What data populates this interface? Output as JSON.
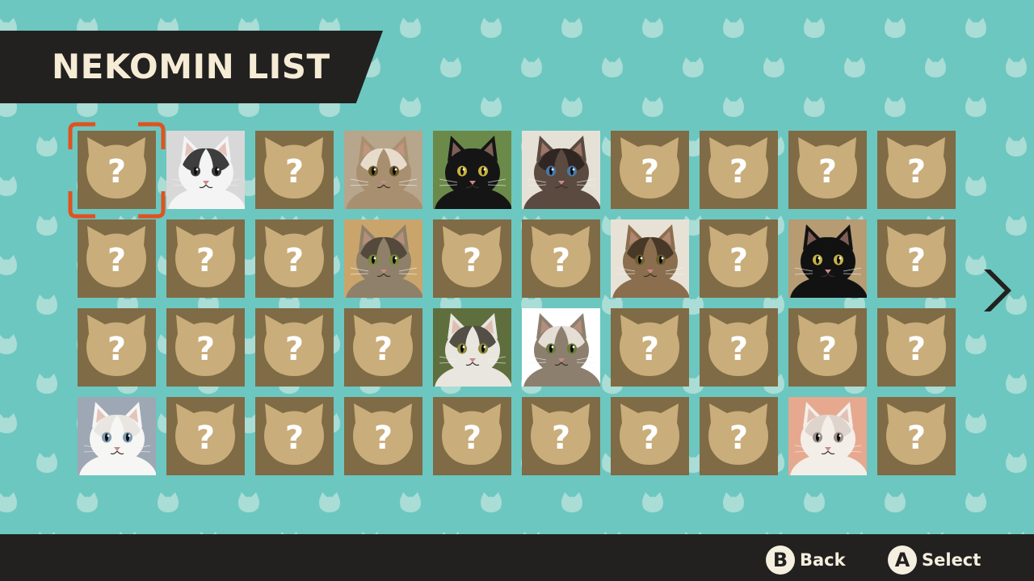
{
  "header": {
    "title": "NEKOMIN LIST"
  },
  "colors": {
    "background": "#6cc7c0",
    "pattern": "#a9ddd6",
    "tile_unknown": "#7f6b45",
    "tile_cat_shape": "#c9ad7a",
    "cursor": "#e0521f",
    "bar": "#222120",
    "bar_text": "#f5efe0"
  },
  "grid": {
    "columns": 10,
    "rows": 4,
    "selected_index": 0,
    "unknown_symbol": "?",
    "tiles": [
      {
        "state": "unknown"
      },
      {
        "state": "discovered",
        "photo": "black-and-white-cat-photo"
      },
      {
        "state": "unknown"
      },
      {
        "state": "discovered",
        "photo": "fluffy-long-haired-cat-photo"
      },
      {
        "state": "discovered",
        "photo": "black-cat-lying-photo"
      },
      {
        "state": "discovered",
        "photo": "siamese-cat-photo"
      },
      {
        "state": "unknown"
      },
      {
        "state": "unknown"
      },
      {
        "state": "unknown"
      },
      {
        "state": "unknown"
      },
      {
        "state": "unknown"
      },
      {
        "state": "unknown"
      },
      {
        "state": "unknown"
      },
      {
        "state": "discovered",
        "photo": "tabby-cat-photo"
      },
      {
        "state": "unknown"
      },
      {
        "state": "unknown"
      },
      {
        "state": "discovered",
        "photo": "tabby-cat-looking-up-photo"
      },
      {
        "state": "unknown"
      },
      {
        "state": "discovered",
        "photo": "black-cat-in-box-photo"
      },
      {
        "state": "unknown"
      },
      {
        "state": "unknown"
      },
      {
        "state": "unknown"
      },
      {
        "state": "unknown"
      },
      {
        "state": "unknown"
      },
      {
        "state": "discovered",
        "photo": "tabby-and-white-cat-photo"
      },
      {
        "state": "discovered",
        "photo": "tabby-cat-closeup-photo"
      },
      {
        "state": "unknown"
      },
      {
        "state": "unknown"
      },
      {
        "state": "unknown"
      },
      {
        "state": "unknown"
      },
      {
        "state": "discovered",
        "photo": "white-cat-photo"
      },
      {
        "state": "unknown"
      },
      {
        "state": "unknown"
      },
      {
        "state": "unknown"
      },
      {
        "state": "unknown"
      },
      {
        "state": "unknown"
      },
      {
        "state": "unknown"
      },
      {
        "state": "unknown"
      },
      {
        "state": "discovered",
        "photo": "sleeping-white-kitten-photo"
      },
      {
        "state": "unknown"
      }
    ]
  },
  "navigation": {
    "next_icon": "chevron-right-icon"
  },
  "footer": {
    "back": {
      "button": "B",
      "label": "Back"
    },
    "select": {
      "button": "A",
      "label": "Select"
    }
  }
}
